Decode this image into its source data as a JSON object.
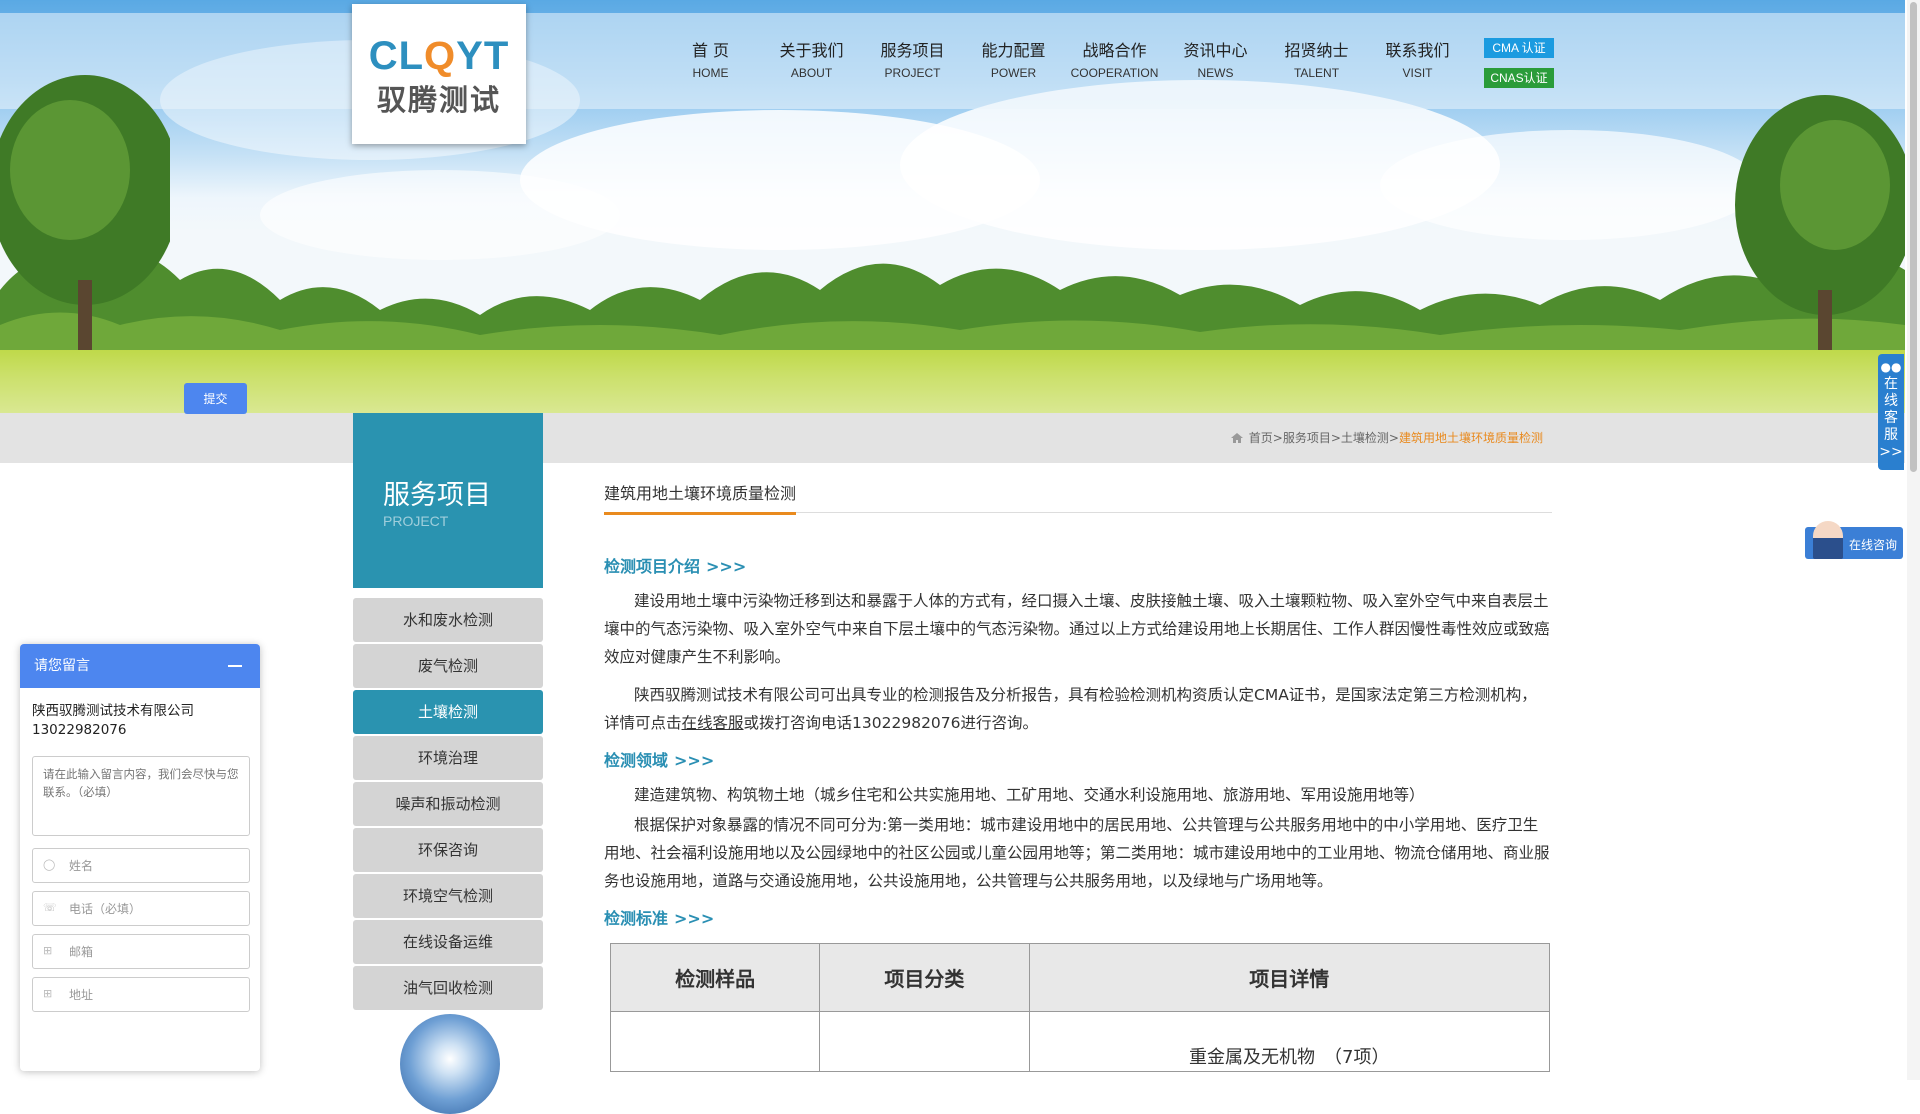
{
  "header": {
    "logo_en_prefix": "CL",
    "logo_en_q": "Q",
    "logo_en_suffix": "YT",
    "logo_cn": "驭腾测试",
    "nav": [
      {
        "cn": "首 页",
        "en": "HOME"
      },
      {
        "cn": "关于我们",
        "en": "ABOUT"
      },
      {
        "cn": "服务项目",
        "en": "PROJECT"
      },
      {
        "cn": "能力配置",
        "en": "POWER"
      },
      {
        "cn": "战略合作",
        "en": "COOPERATION"
      },
      {
        "cn": "资讯中心",
        "en": "NEWS"
      },
      {
        "cn": "招贤纳士",
        "en": "TALENT"
      },
      {
        "cn": "联系我们",
        "en": "VISIT"
      }
    ],
    "cert_cma": "CMA 认证",
    "cert_cnas": "CNAS认证"
  },
  "breadcrumb": {
    "items": [
      "首页",
      "服务项目",
      "土壤检测"
    ],
    "separator": ">",
    "current": "建筑用地土壤环境质量检测"
  },
  "sidebar": {
    "title": "服务项目",
    "subtitle": "PROJECT",
    "items": [
      "水和废水检测",
      "废气检测",
      "土壤检测",
      "环境治理",
      "噪声和振动检测",
      "环保咨询",
      "环境空气检测",
      "在线设备运维",
      "油气回收检测"
    ],
    "active_index": 2
  },
  "content": {
    "page_title": "建筑用地土壤环境质量检测",
    "section_arrow": ">>>",
    "sec1_title": "检测项目介绍",
    "sec1_p1": "建设用地土壤中污染物迁移到达和暴露于人体的方式有，经口摄入土壤、皮肤接触土壤、吸入土壤颗粒物、吸入室外空气中来自表层土壤中的气态污染物、吸入室外空气中来自下层土壤中的气态污染物。通过以上方式给建设用地上长期居住、工作人群因慢性毒性效应或致癌效应对健康产生不利影响。",
    "sec1_p2_before": "陕西驭腾测试技术有限公司可出具专业的检测报告及分析报告，具有检验检测机构资质认定CMA证书，是国家法定第三方检测机构，详情可点击",
    "sec1_p2_link": "在线客服",
    "sec1_p2_after": "或拨打咨询电话13022982076进行咨询。",
    "sec2_title": "检测领域",
    "sec2_p1": "建造建筑物、构筑物土地（城乡住宅和公共实施用地、工矿用地、交通水利设施用地、旅游用地、军用设施用地等）",
    "sec2_p2": "根据保护对象暴露的情况不同可分为:第一类用地：城市建设用地中的居民用地、公共管理与公共服务用地中的中小学用地、医疗卫生用地、社会福利设施用地以及公园绿地中的社区公园或儿童公园用地等；第二类用地：城市建设用地中的工业用地、物流仓储用地、商业服务也设施用地，道路与交通设施用地，公共设施用地，公共管理与公共服务用地，以及绿地与广场用地等。",
    "sec3_title": "检测标准",
    "table": {
      "headers": [
        "检测样品",
        "项目分类",
        "项目详情"
      ],
      "row1": [
        "",
        "",
        "重金属及无机物　（7项）"
      ]
    }
  },
  "float": {
    "service_tab": [
      "在",
      "线",
      "客",
      "服"
    ],
    "service_tab_more": ">>",
    "consult_label": "在线咨询"
  },
  "message_box": {
    "title": "请您留言",
    "company": "陕西驭腾测试技术有限公司13022982076",
    "textarea_placeholder": "请在此输入留言内容，我们会尽快与您联系。（必填）",
    "name_placeholder": "姓名",
    "phone_placeholder": "电话（必填）",
    "email_placeholder": "邮箱",
    "address_placeholder": "地址",
    "submit_label": "提交"
  },
  "colors": {
    "accent_teal": "#2a93b0",
    "accent_orange": "#e98a1e",
    "widget_blue": "#4d86ef"
  }
}
